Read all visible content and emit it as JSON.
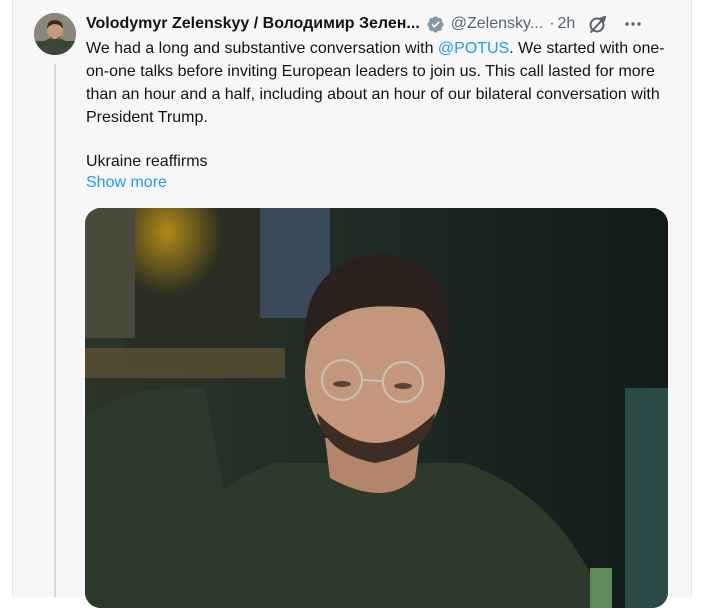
{
  "tweet": {
    "author_name": "Volodymyr Zelenskyy / Володимир Зелен...",
    "handle": "@Zelensky...",
    "separator": "·",
    "time": "2h",
    "text_before_mention": "We had a long and substantive conversation with ",
    "mention": "@POTUS",
    "text_after_mention": ". We started with one-on-one talks before inviting European leaders to join us. This call lasted for more than an hour and a half, including about an hour of our bilateral conversation with President Trump.",
    "text_second_paragraph": "Ukraine reaffirms",
    "show_more": "Show more"
  },
  "icons": {
    "verified": "verified-badge-icon",
    "grok": "grok-icon",
    "more": "more-options-icon"
  },
  "colors": {
    "link": "#1d9bf0",
    "secondary_text": "#536471",
    "primary_text": "#0f1419"
  }
}
